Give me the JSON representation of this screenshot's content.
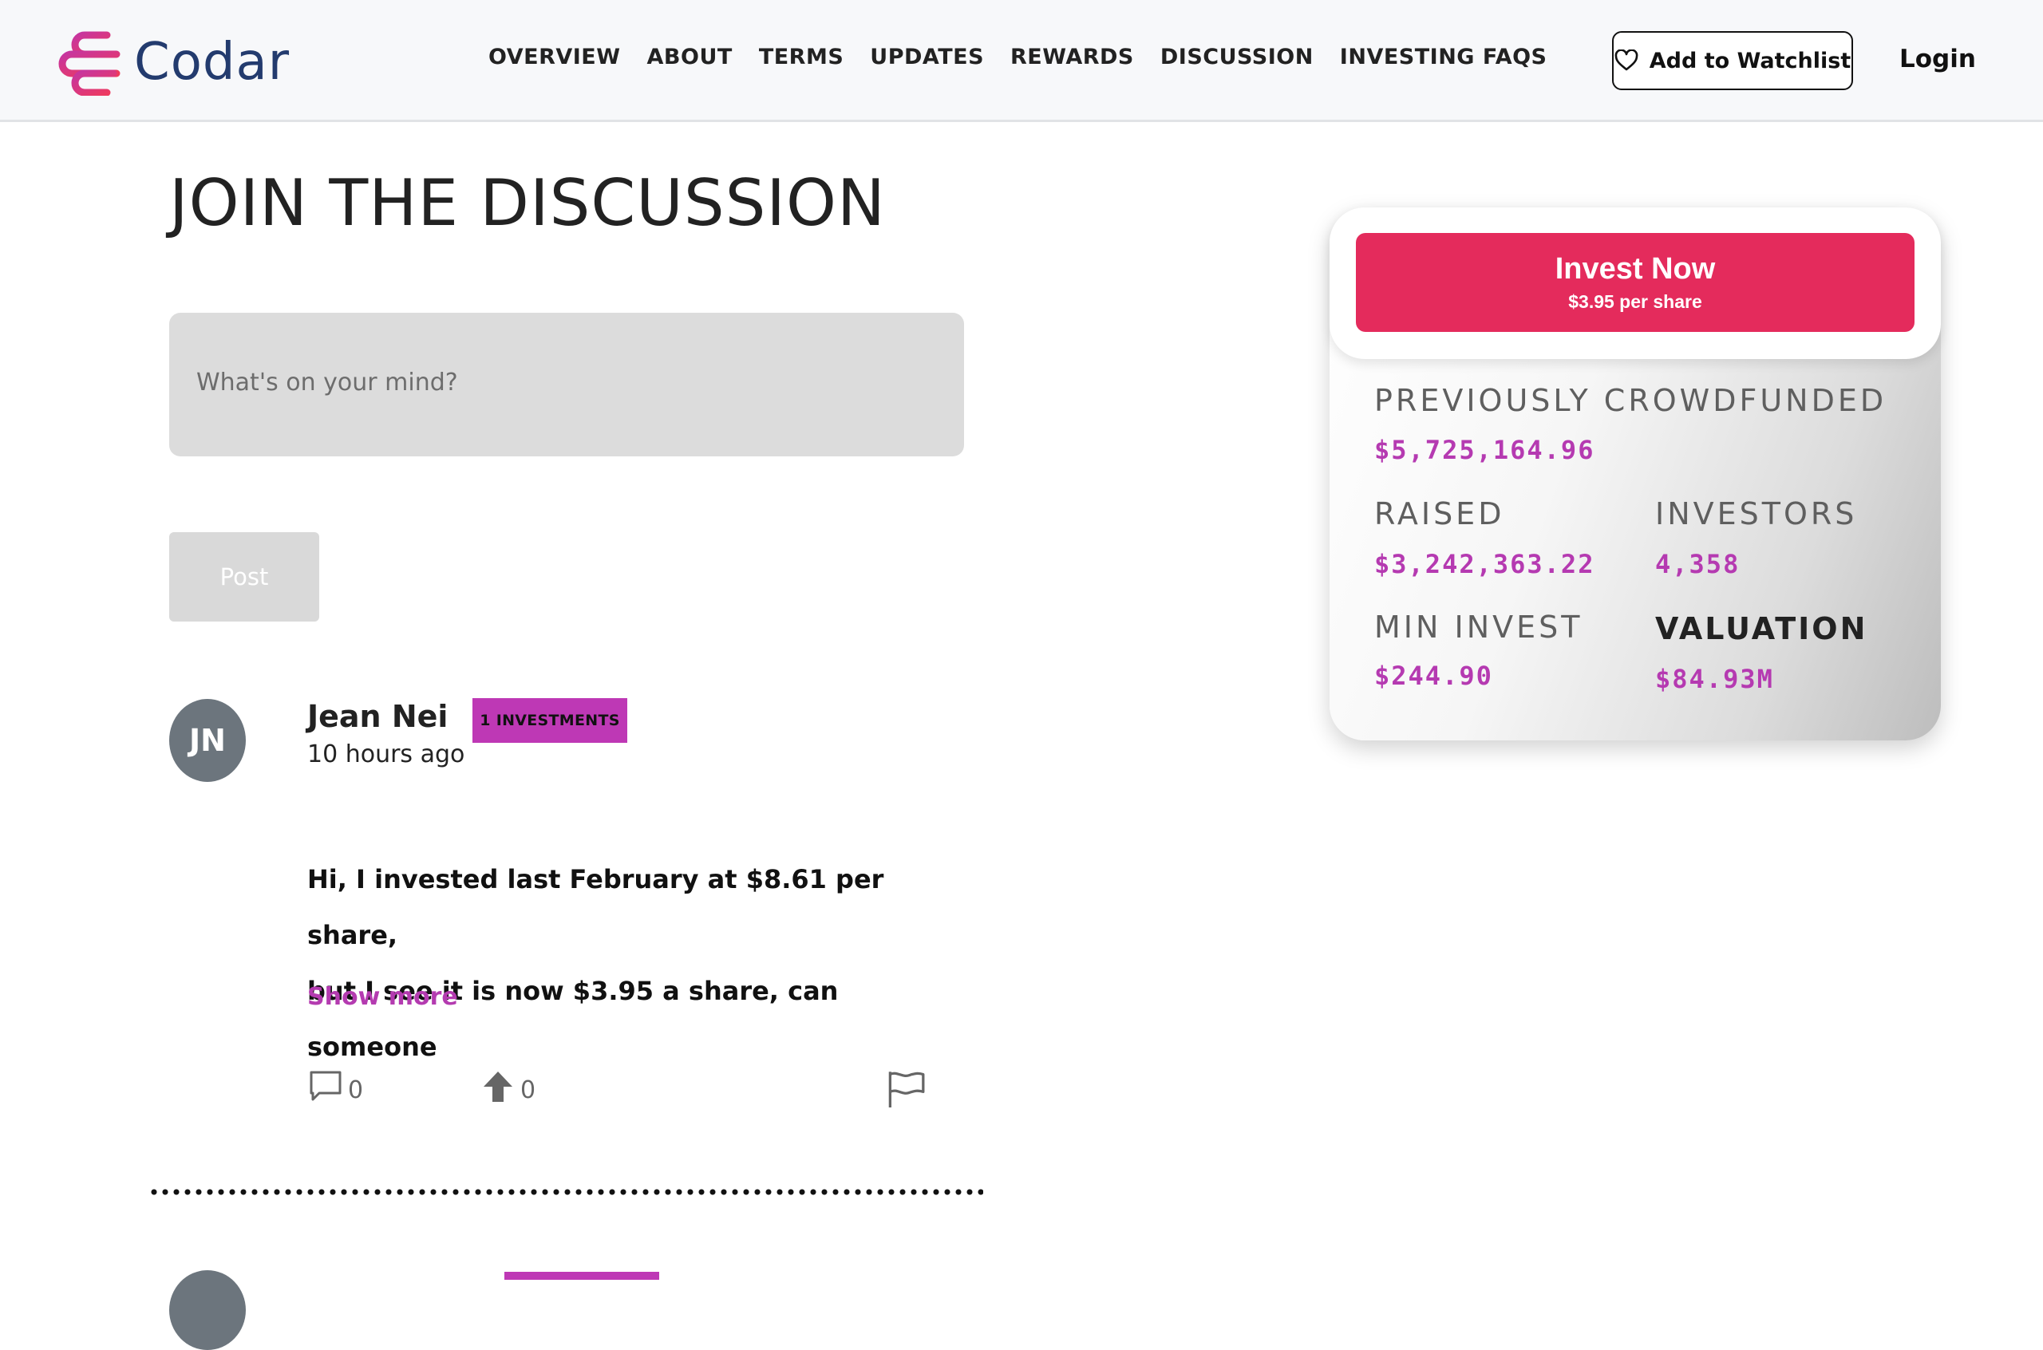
{
  "header": {
    "brand": "Codar",
    "nav": [
      "OVERVIEW",
      "ABOUT",
      "TERMS",
      "UPDATES",
      "REWARDS",
      "DISCUSSION",
      "INVESTING FAQS"
    ],
    "watchlist_label": "Add to Watchlist",
    "login_label": "Login"
  },
  "main": {
    "title": "JOIN THE DISCUSSION",
    "composer_placeholder": "What's on your mind?",
    "post_label": "Post"
  },
  "comment": {
    "initials": "JN",
    "author": "Jean Nei",
    "badge": "1 INVESTMENTS",
    "time": "10 hours ago",
    "body_line1": "Hi, I invested last February at $8.61 per share,",
    "body_line2": "but I see it is now $3.95 a share, can someone",
    "show_more": "Show more",
    "reply_count": "0",
    "upvote_count": "0"
  },
  "invest_card": {
    "button_title": "Invest Now",
    "button_sub": "$3.95 per share",
    "previously_label": "PREVIOUSLY CROWDFUNDED",
    "previously_value": "$5,725,164.96",
    "raised_label": "RAISED",
    "raised_value": "$3,242,363.22",
    "investors_label": "INVESTORS",
    "investors_value": "4,358",
    "min_label": "MIN INVEST",
    "min_value": "$244.90",
    "valuation_label": "VALUATION",
    "valuation_value": "$84.93M"
  },
  "colors": {
    "accent_pink": "#e42b5c",
    "accent_magenta": "#be38b5",
    "brand_navy": "#233b6e"
  }
}
